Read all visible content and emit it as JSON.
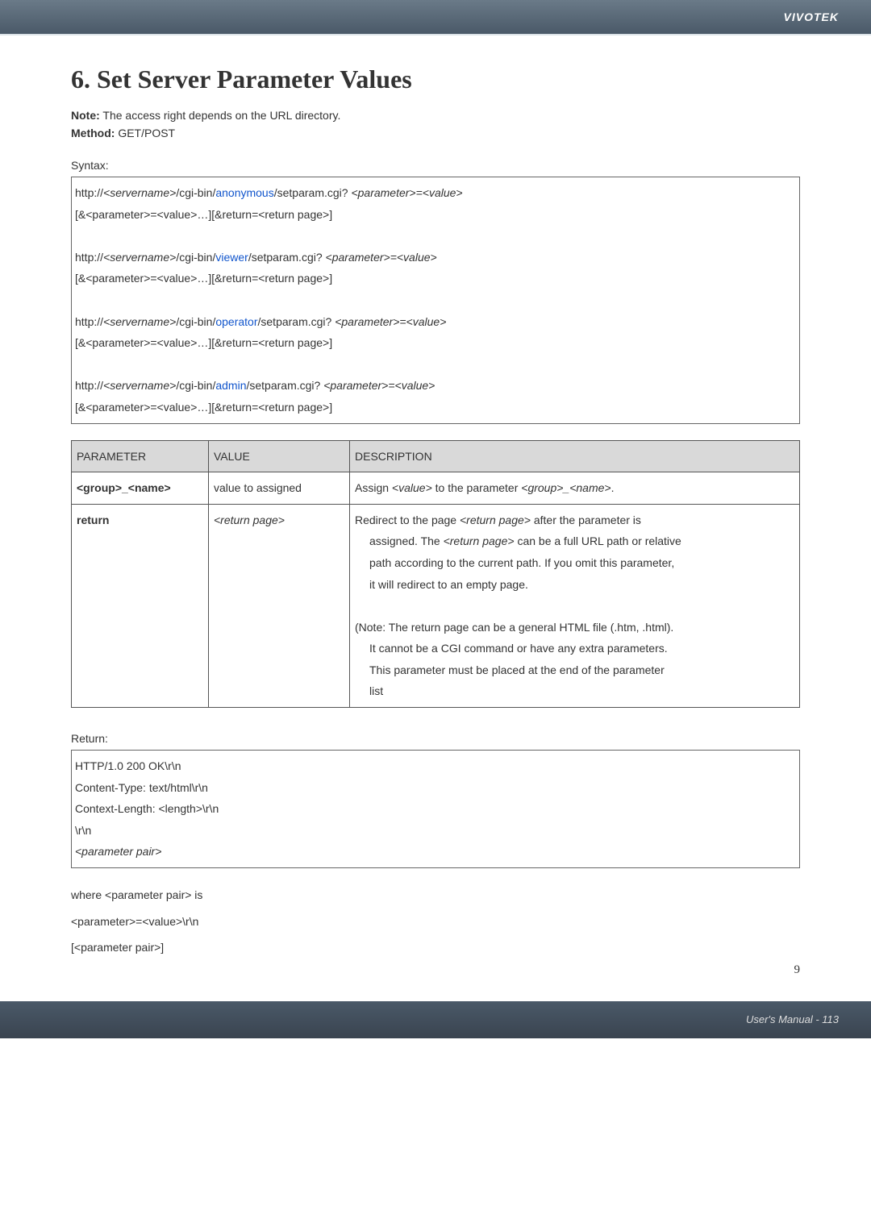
{
  "brand": "VIVOTEK",
  "title": "6. Set Server Parameter Values",
  "note_label": "Note:",
  "note_text": " The access right depends on the URL directory.",
  "method_label": "Method:",
  "method_text": " GET/POST",
  "syntax_label": "Syntax:",
  "syntax": {
    "blocks": [
      {
        "pre": "http://",
        "srv": "<servername>",
        "mid1": "/cgi-bin/",
        "role": "anonymous",
        "mid2": "/setparam.cgi? ",
        "pv": "<parameter>=<value>",
        "extra": "[&<parameter>=<value>…][&return=<return page>]"
      },
      {
        "pre": "http://",
        "srv": "<servername>",
        "mid1": "/cgi-bin/",
        "role": "viewer",
        "mid2": "/setparam.cgi? ",
        "pv": "<parameter>=<value>",
        "extra": "[&<parameter>=<value>…][&return=<return page>]"
      },
      {
        "pre": "http://",
        "srv": "<servername>",
        "mid1": "/cgi-bin/",
        "role": "operator",
        "mid2": "/setparam.cgi? ",
        "pv": "<parameter>=<value>",
        "extra": "[&<parameter>=<value>…][&return=<return page>]"
      },
      {
        "pre": "http://",
        "srv": "<servername>",
        "mid1": "/cgi-bin/",
        "role": "admin",
        "mid2": "/setparam.cgi? ",
        "pv": "<parameter>=<value>",
        "extra": "[&<parameter>=<value>…][&return=<return page>]"
      }
    ]
  },
  "table": {
    "headers": {
      "p": "PARAMETER",
      "v": "VALUE",
      "d": "DESCRIPTION"
    },
    "row1": {
      "p": "<group>_<name>",
      "v": "value to assigned",
      "d_pre": "Assign ",
      "d_val": "<value>",
      "d_mid": " to the parameter ",
      "d_gn": "<group>_<name>",
      "d_post": "."
    },
    "row2": {
      "p": "return",
      "v": "<return page>",
      "d1a": "Redirect to the page ",
      "d1b": "<return page>",
      "d1c": " after the parameter is",
      "d2a": "assigned. The ",
      "d2b": "<return page>",
      "d2c": " can be a full URL path or relative",
      "d3": "path according to the current path. If you omit this parameter,",
      "d4": "it will redirect to an empty page.",
      "d5": "(Note: The return page can be a general HTML file (.htm, .html).",
      "d6": "It cannot be a CGI command or have any extra parameters.",
      "d7": "This parameter must be placed at the end of the parameter",
      "d8": "list"
    }
  },
  "return_label": "Return:",
  "return_box": {
    "l1": "HTTP/1.0 200 OK\\r\\n",
    "l2": "Content-Type: text/html\\r\\n",
    "l3": "Context-Length: <length>\\r\\n",
    "l4": "\\r\\n",
    "l5": "<parameter pair>"
  },
  "after_return": {
    "l1": "where <parameter pair> is",
    "l2": "<parameter>=<value>\\r\\n",
    "l3": "[<parameter pair>]"
  },
  "page_number": "9",
  "footer": "User's Manual - 113"
}
